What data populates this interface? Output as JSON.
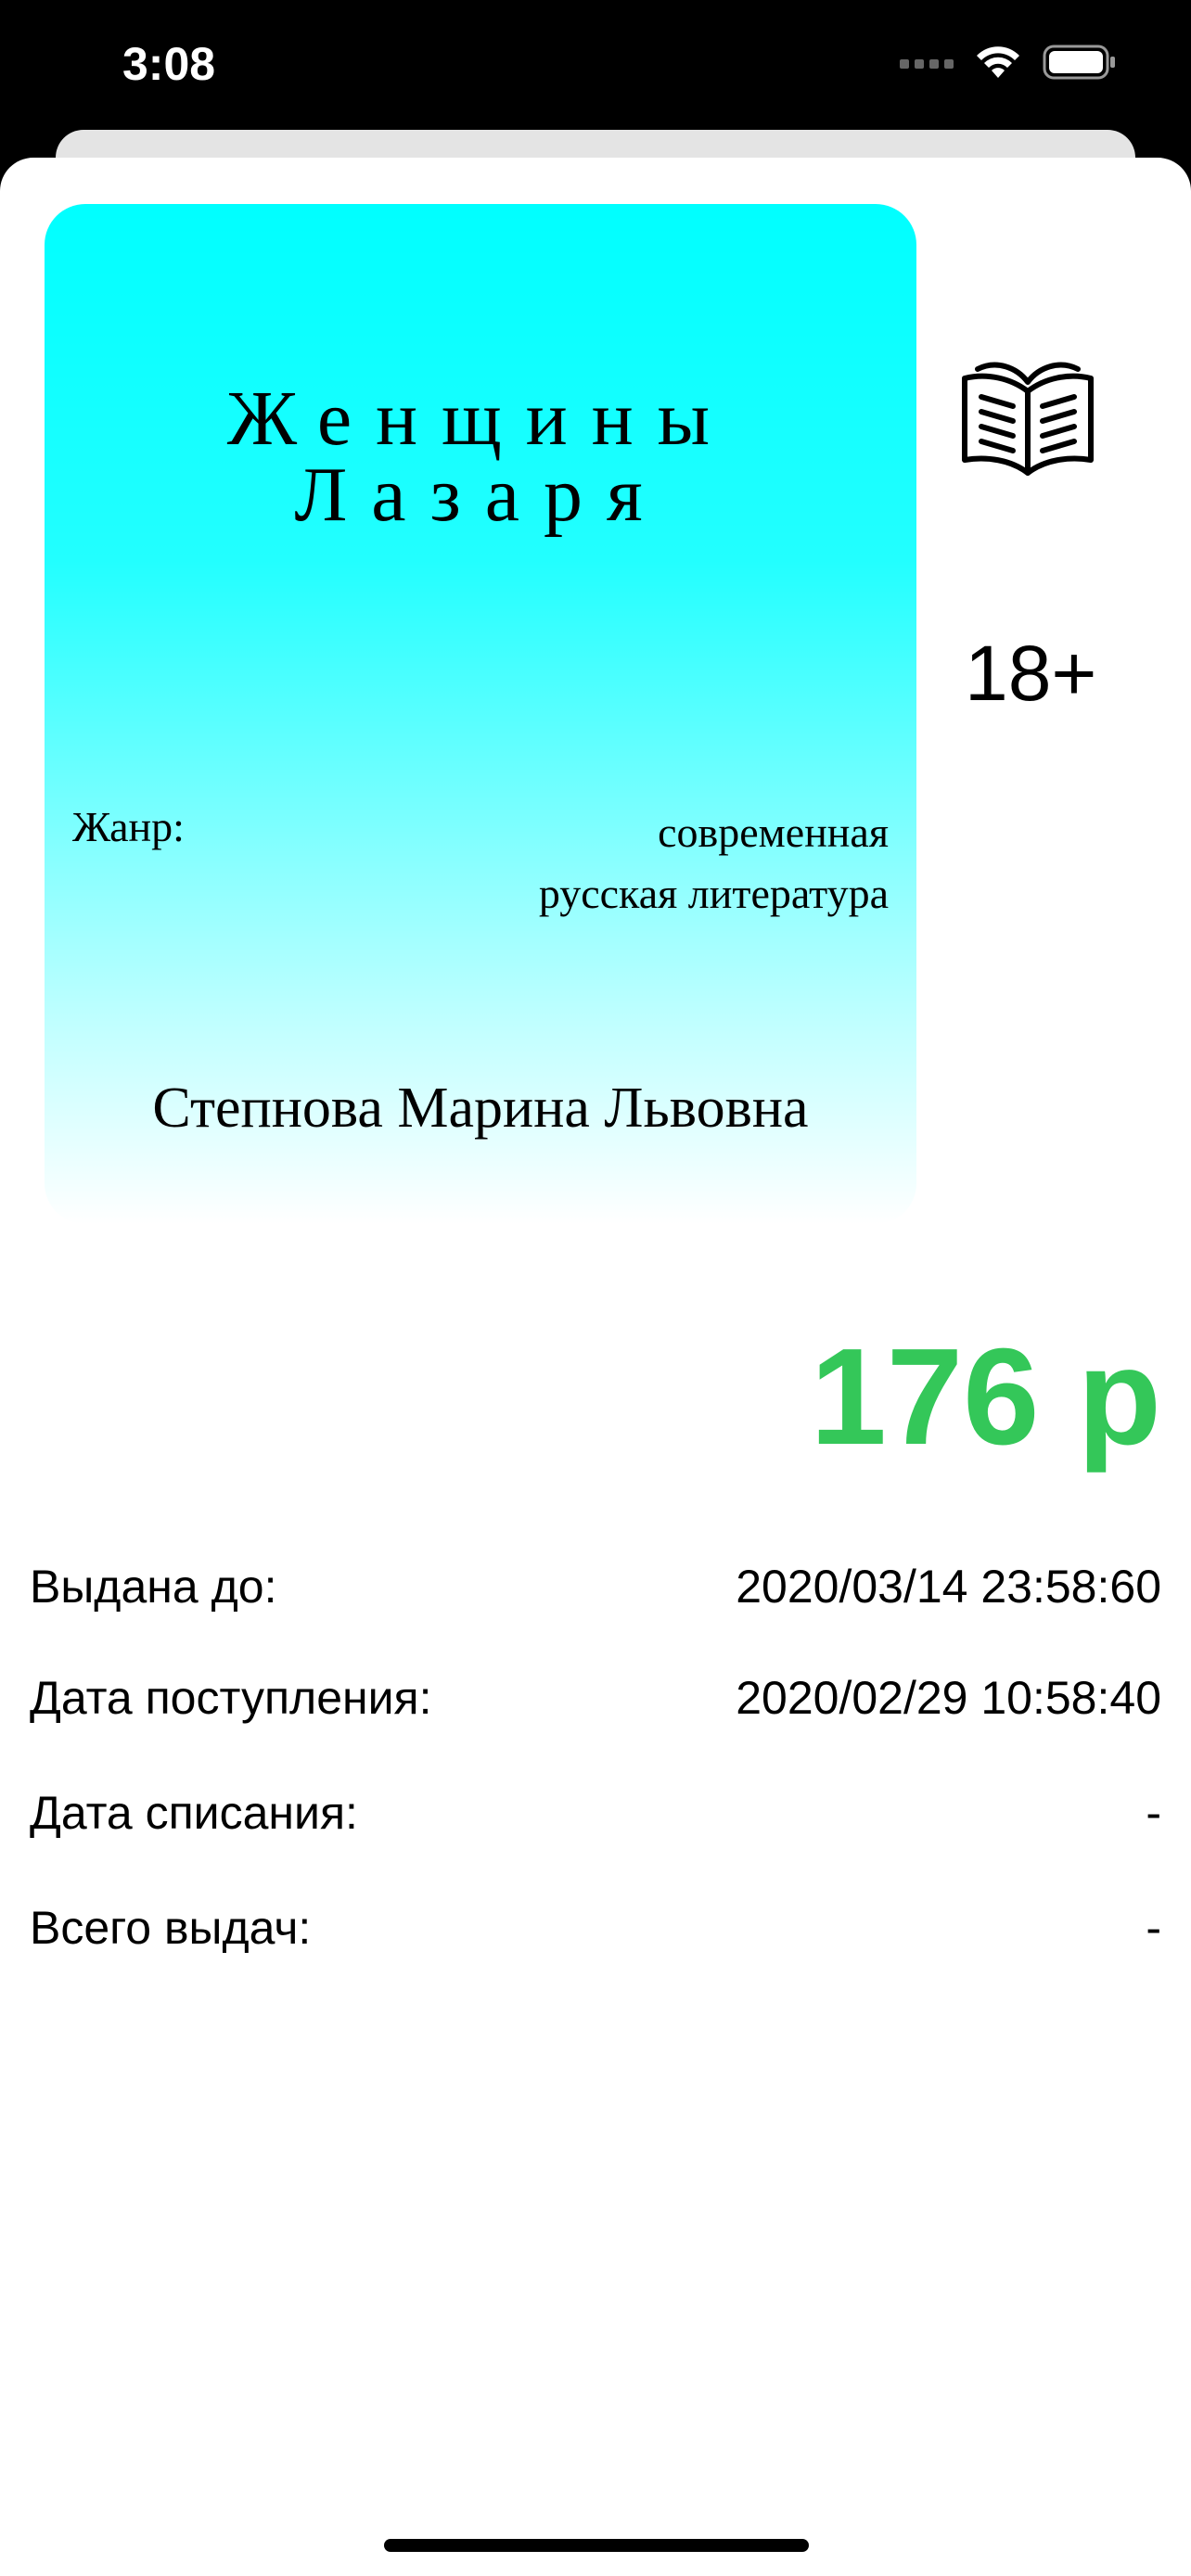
{
  "status_bar": {
    "time": "3:08"
  },
  "book": {
    "title_line1": "Женщины",
    "title_line2": "Лазаря",
    "genre_label": "Жанр:",
    "genre_line1": "современная",
    "genre_line2": "русская литература",
    "author": "Степнова Марина Львовна",
    "age_rating": "18+",
    "price": "176 р"
  },
  "details": [
    {
      "label": "Выдана до:",
      "value": "2020/03/14 23:58:60"
    },
    {
      "label": "Дата поступления:",
      "value": "2020/02/29 10:58:40"
    },
    {
      "label": "Дата списания:",
      "value": "-"
    },
    {
      "label": "Всего выдач:",
      "value": "-"
    }
  ],
  "colors": {
    "price": "#34c759",
    "cover_top": "#00ffff"
  },
  "icons": [
    "cellular-signal-icon",
    "wifi-icon",
    "battery-icon",
    "open-book-icon"
  ]
}
